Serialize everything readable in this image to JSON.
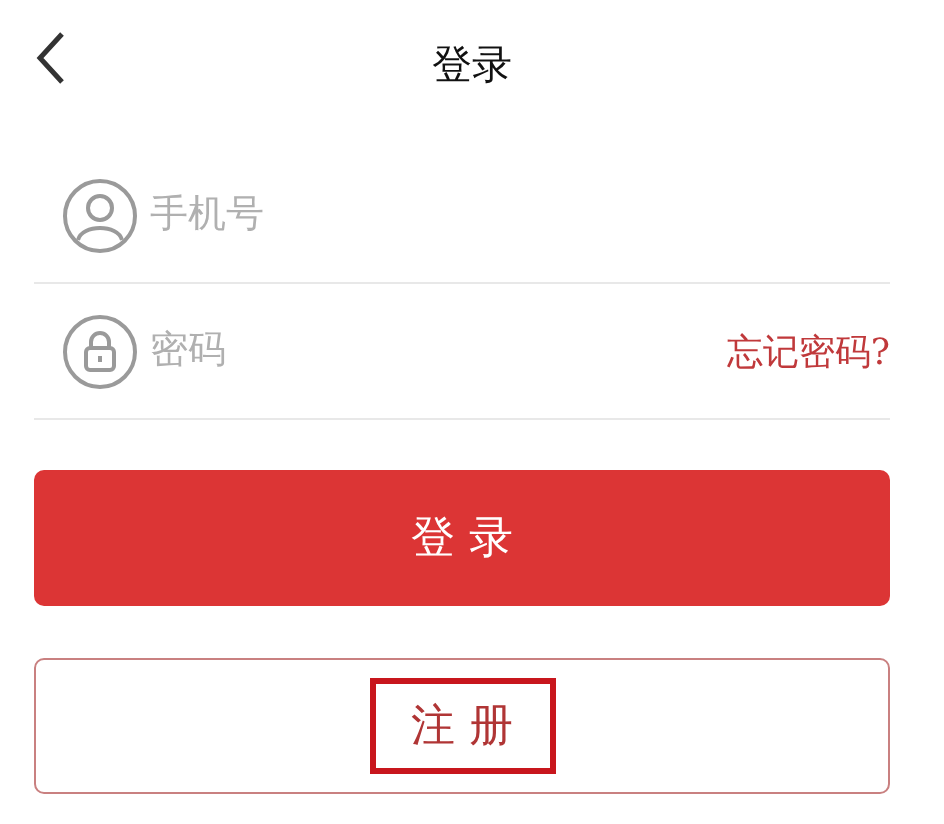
{
  "header": {
    "title": "登录"
  },
  "fields": [
    {
      "kind": "phone",
      "placeholder": "手机号"
    },
    {
      "kind": "password",
      "placeholder": "密码",
      "link": "忘记密码?"
    }
  ],
  "buttons": [
    {
      "kind": "primary",
      "label": "登 录",
      "highlighted": false
    },
    {
      "kind": "outline",
      "label": "注 册",
      "highlighted": true
    }
  ]
}
